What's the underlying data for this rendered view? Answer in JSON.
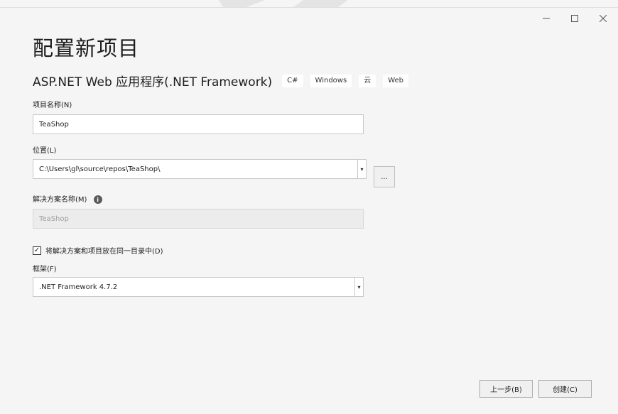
{
  "window": {
    "controls": {
      "minimize": "minimize-icon",
      "maximize": "maximize-icon",
      "close": "close-icon"
    }
  },
  "page": {
    "heading": "配置新项目",
    "project_type": "ASP.NET Web 应用程序(.NET Framework)",
    "tags": [
      "C#",
      "Windows",
      "云",
      "Web"
    ]
  },
  "form": {
    "project_name_label": "项目名称(N)",
    "project_name_value": "TeaShop",
    "location_label": "位置(L)",
    "location_value": "C:\\Users\\gl\\source\\repos\\TeaShop\\",
    "browse_label": "...",
    "solution_name_label": "解决方案名称(M)",
    "solution_name_info_icon": "info-icon",
    "solution_name_value": "TeaShop",
    "same_dir_checkbox_label": "将解决方案和项目放在同一目录中(D)",
    "same_dir_checked": true,
    "framework_label": "框架(F)",
    "framework_value": ".NET Framework 4.7.2"
  },
  "footer": {
    "back_label": "上一步(B)",
    "create_label": "创建(C)"
  },
  "colors": {
    "background": "#f5f5f5",
    "field_border": "#c8c8c8",
    "disabled_field": "#ececec"
  }
}
